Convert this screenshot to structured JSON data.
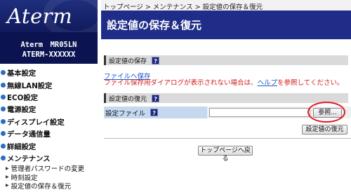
{
  "sidebar": {
    "logo": "Aterm",
    "model_line1": "Aterm　MR05LN",
    "model_line2": "ATERM-XXXXXX",
    "items": [
      {
        "label": "基本設定"
      },
      {
        "label": "無線LAN設定"
      },
      {
        "label": "ECO設定"
      },
      {
        "label": "電源設定"
      },
      {
        "label": "ディスプレイ設定"
      },
      {
        "label": "データ通信量"
      },
      {
        "label": "詳細設定"
      },
      {
        "label": "メンテナンス"
      }
    ],
    "sub_items": [
      {
        "label": "管理者パスワードの変更"
      },
      {
        "label": "時刻設定"
      },
      {
        "label": "設定値の保存＆復元"
      }
    ]
  },
  "main": {
    "breadcrumb": "トップページ > メンテナンス > 設定値の保存＆復元",
    "title": "設定値の保存＆復元",
    "save_section": {
      "heading": "設定値の保存",
      "help": "?",
      "link": "ファイルへ保存",
      "warning_prefix": "ファイル保存用ダイアログが表示されない場合は、",
      "warning_link": "ヘルプ",
      "warning_suffix": "を参照してください。"
    },
    "restore_section": {
      "heading": "設定値の復元",
      "help": "?",
      "row_label": "設定ファイル",
      "row_help": "?",
      "file_value": "",
      "browse_button": "参照...",
      "restore_button": "設定値の復元"
    },
    "back_button": "トップページへ戻る"
  },
  "colors": {
    "title_bar": "#1f2d88",
    "sidebar_logo": "#1f2f7e",
    "warning_text": "#d21b1b",
    "link": "#1a55c9",
    "highlight_ring": "#e8141c"
  }
}
